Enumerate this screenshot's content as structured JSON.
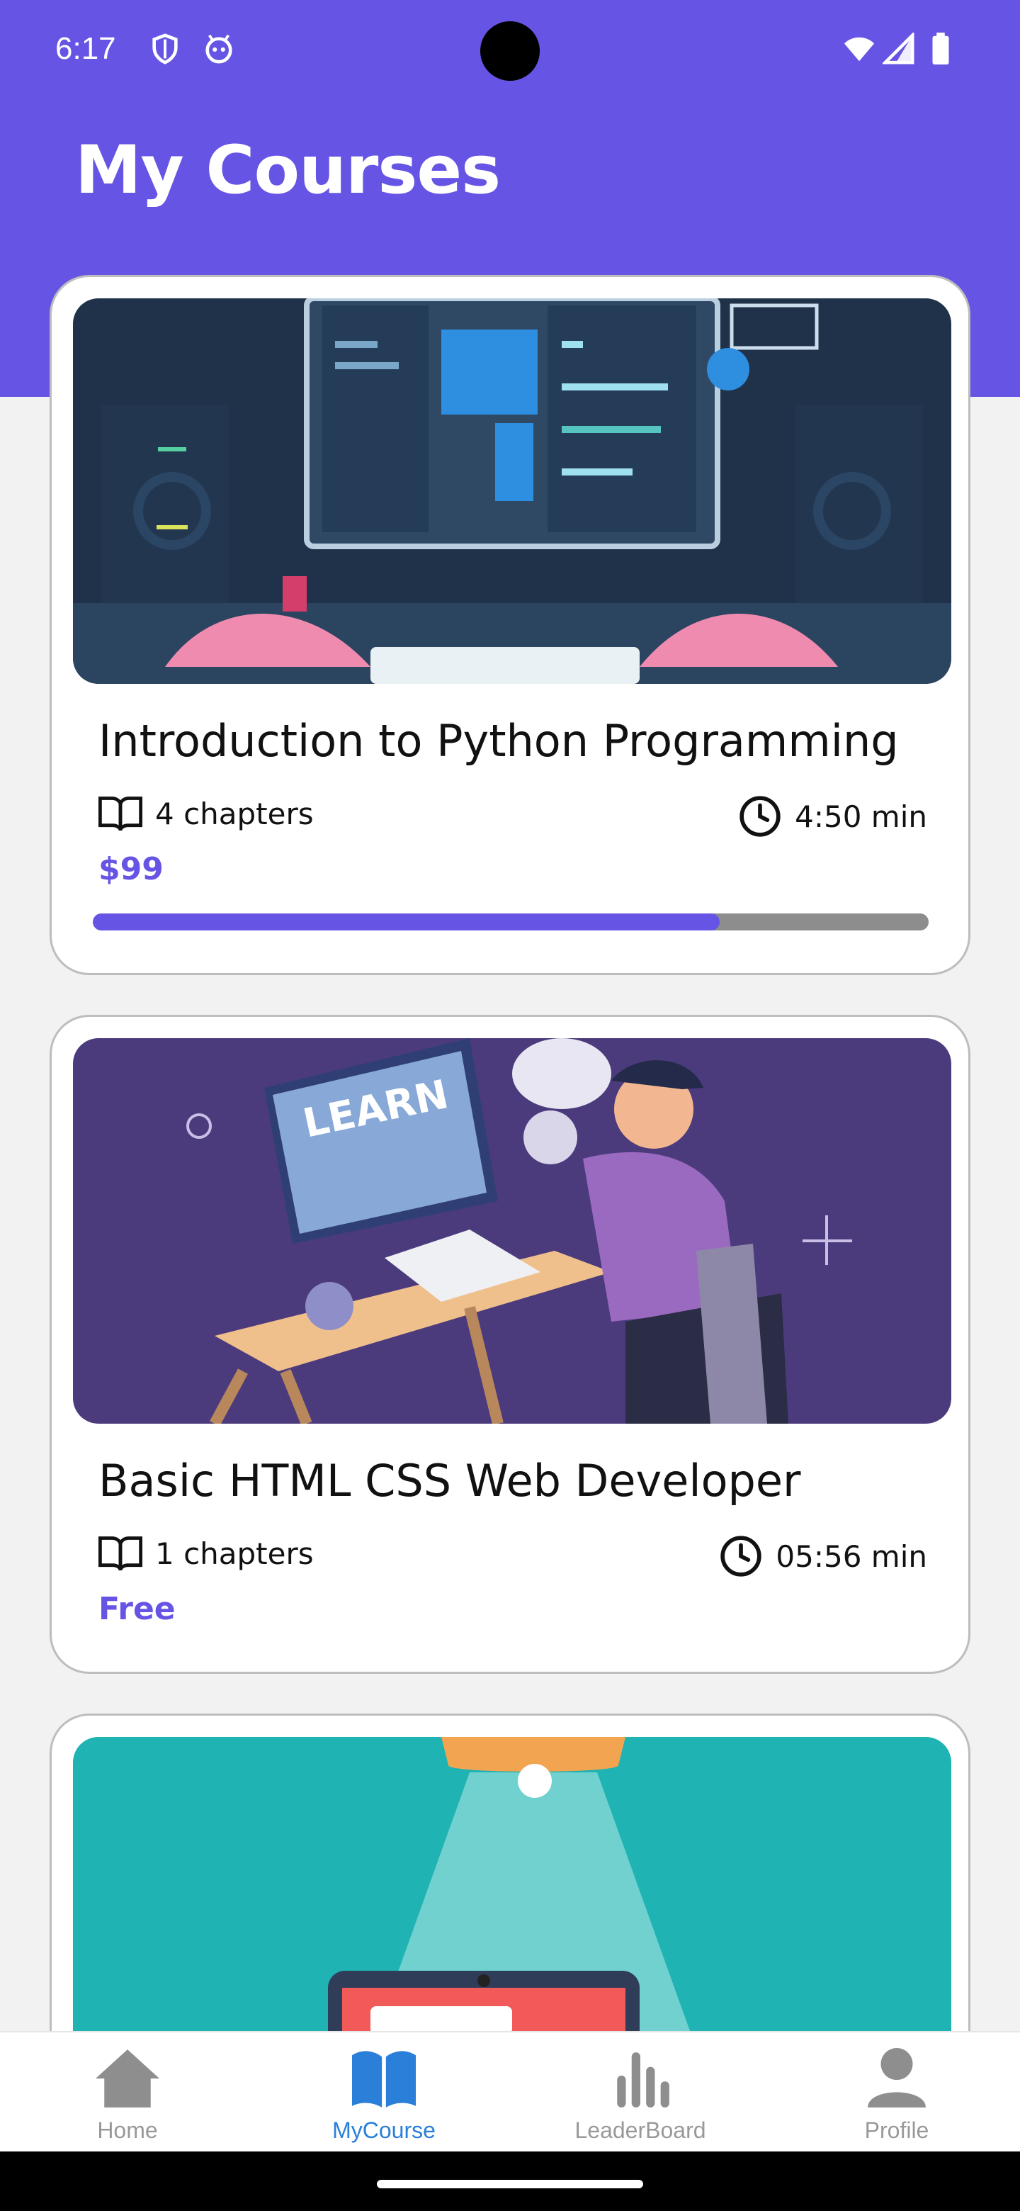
{
  "status_bar": {
    "time": "6:17"
  },
  "header": {
    "title": "My Courses"
  },
  "courses": [
    {
      "title": "Introduction to Python Programming",
      "chapters": "4 chapters",
      "duration": "4:50 min",
      "price": "$99",
      "progress": 0.75
    },
    {
      "title": "Basic HTML CSS Web Developer",
      "chapters": "1 chapters",
      "duration": "05:56 min",
      "price": "Free"
    }
  ],
  "bottom_nav": [
    {
      "label": "Home",
      "icon": "home-icon"
    },
    {
      "label": "MyCourse",
      "icon": "book-open-icon",
      "active": true
    },
    {
      "label": "LeaderBoard",
      "icon": "bar-chart-icon"
    },
    {
      "label": "Profile",
      "icon": "person-icon"
    }
  ],
  "colors": {
    "accent": "#6655e4",
    "nav_active": "#2a7fd8",
    "nav_inactive": "#999999"
  }
}
